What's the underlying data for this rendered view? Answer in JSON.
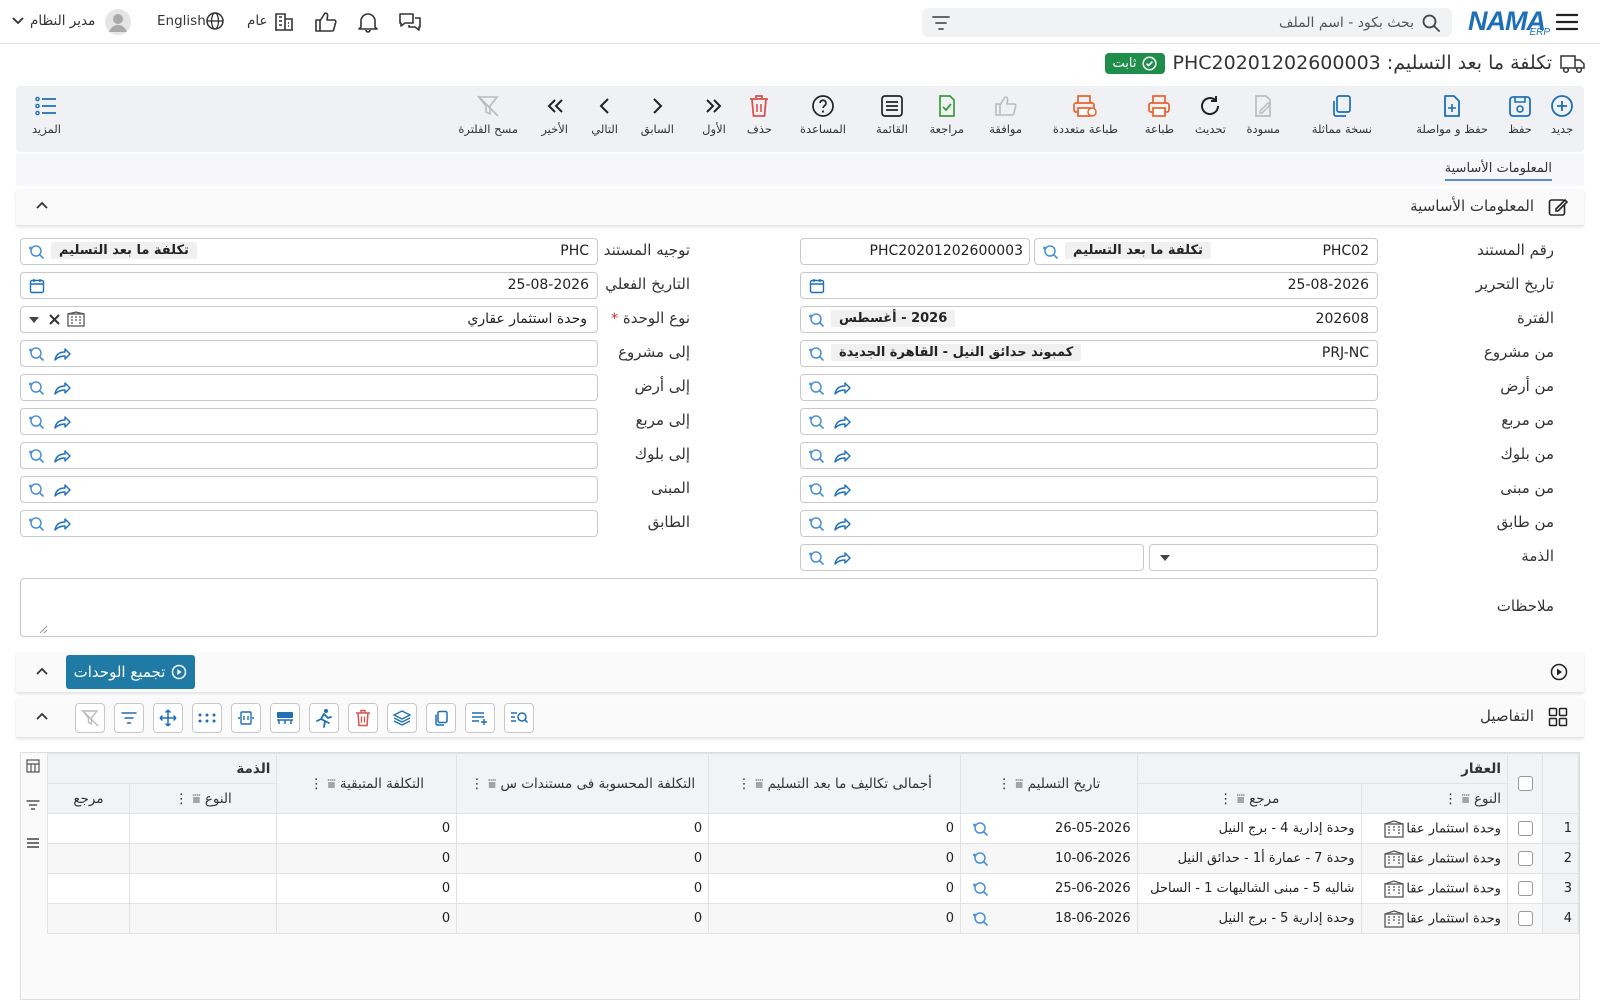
{
  "topbar": {
    "logo": "NAMA",
    "logo_sub": "ERP",
    "search_placeholder": "بحث بكود - اسم الملف",
    "user": "مدير النظام",
    "language": "English",
    "company": "عام"
  },
  "document": {
    "title": "تكلفة ما بعد التسليم: PHC20201202600003",
    "status": "ثابت"
  },
  "toolbar": {
    "new": "جديد",
    "save": "حفظ",
    "save_continue": "حفظ و مواصلة",
    "duplicate": "نسخة مماثلة",
    "draft": "مسودة",
    "refresh": "تحديث",
    "print": "طباعة",
    "multi_print": "طباعة متعددة",
    "approve": "موافقة",
    "review": "مراجعة",
    "list": "القائمة",
    "help": "المساعدة",
    "delete": "حذف",
    "first": "الأول",
    "previous": "السابق",
    "next": "التالي",
    "last": "الأخير",
    "clear_filter": "مسح الفلترة",
    "more": "المزيد"
  },
  "tabs": {
    "basic": "المعلومات الأساسية"
  },
  "section_basic": {
    "title": "المعلومات الأساسية"
  },
  "form": {
    "doc_number": {
      "label": "رقم المستند",
      "code": "PHC02",
      "desc": "تكلفة ما بعد التسليم",
      "number": "PHC20201202600003"
    },
    "doc_direction": {
      "label": "توجيه المستند",
      "code": "PHC",
      "desc": "تكلفة ما بعد التسليم"
    },
    "edit_date": {
      "label": "تاريخ التحرير",
      "value": "25-08-2026"
    },
    "actual_date": {
      "label": "التاريخ الفعلي",
      "value": "25-08-2026"
    },
    "period": {
      "label": "الفترة",
      "code": "202608",
      "desc": "2026 - أغسطس"
    },
    "unit_type": {
      "label": "نوع الوحدة",
      "required": "*",
      "value": "وحدة استثمار عقاري"
    },
    "from_project": {
      "label": "من مشروع",
      "code": "PRJ-NC",
      "desc": "كمبوند حدائق النيل - القاهرة الجديدة"
    },
    "to_project": {
      "label": "إلى مشروع"
    },
    "from_land": {
      "label": "من أرض"
    },
    "to_land": {
      "label": "إلى أرض"
    },
    "from_square": {
      "label": "من مربع"
    },
    "to_square": {
      "label": "إلى مربع"
    },
    "from_block": {
      "label": "من بلوك"
    },
    "to_block": {
      "label": "إلى بلوك"
    },
    "from_building": {
      "label": "من مبنى"
    },
    "building": {
      "label": "المبنى"
    },
    "from_floor": {
      "label": "من طابق"
    },
    "floor": {
      "label": "الطابق"
    },
    "liability": {
      "label": "الذمة"
    },
    "notes": {
      "label": "ملاحظات"
    }
  },
  "actions": {
    "collect_units": "تجميع الوحدات"
  },
  "section_details": {
    "title": "التفاصيل"
  },
  "table": {
    "group_property": "العقار",
    "group_liability": "الذمة",
    "col_type": "النوع",
    "col_ref": "مرجع",
    "col_delivery_date": "تاريخ التسليم",
    "col_total_cost": "أجمالى تكاليف ما بعد التسليم",
    "col_calc_cost": "التكلفة المحسوبة فى مستندات س",
    "col_remaining": "التكلفة المتبقية",
    "col_liab_type": "النوع",
    "col_liab_ref": "مرجع",
    "rows": [
      {
        "num": "1",
        "type": "وحدة استثمار عقا",
        "ref": "وحدة إدارية 4 - برج النيل",
        "date": "26-05-2026",
        "total": "0",
        "calc": "0",
        "remaining": "0"
      },
      {
        "num": "2",
        "type": "وحدة استثمار عقا",
        "ref": "وحدة 7 - عمارة أ1 - حدائق النيل",
        "date": "10-06-2026",
        "total": "0",
        "calc": "0",
        "remaining": "0"
      },
      {
        "num": "3",
        "type": "وحدة استثمار عقا",
        "ref": "شاليه 5 - مبنى الشاليهات 1 - الساحل",
        "date": "25-06-2026",
        "total": "0",
        "calc": "0",
        "remaining": "0"
      },
      {
        "num": "4",
        "type": "وحدة استثمار عقا",
        "ref": "وحدة إدارية 5 - برج النيل",
        "date": "18-06-2026",
        "total": "0",
        "calc": "0",
        "remaining": "0"
      }
    ]
  },
  "colors": {
    "primary": "#1d6fb8",
    "status_green": "#1e8e4a",
    "action_blue": "#1f7aa6",
    "delete_red": "#d9534f",
    "print_orange": "#e8622c",
    "review_green": "#3a9b3a"
  }
}
